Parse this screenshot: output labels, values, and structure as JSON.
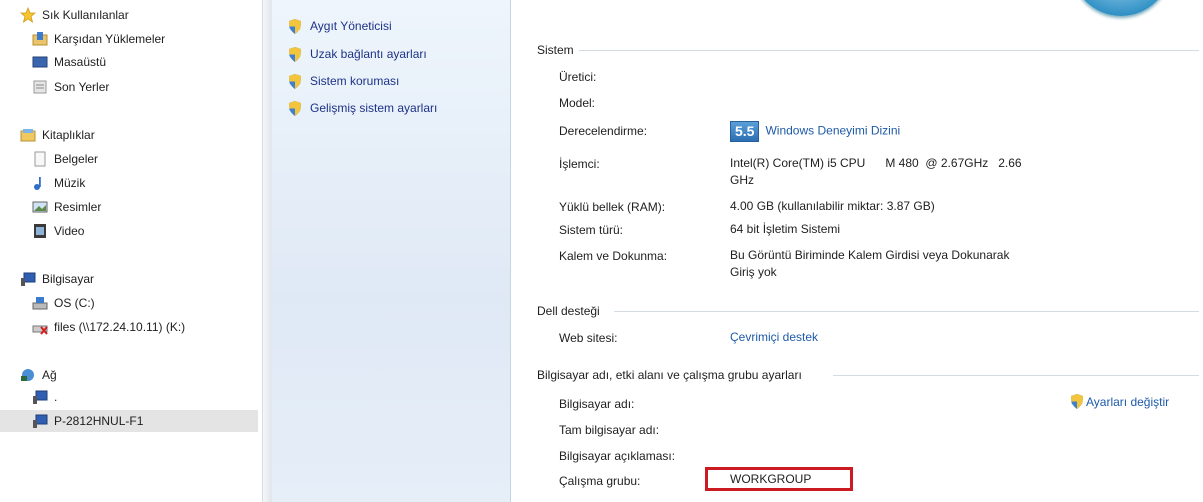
{
  "sidebar": {
    "favorites": {
      "label": "Sık Kullanılanlar",
      "items": [
        "Karşıdan Yüklemeler",
        "Masaüstü",
        "Son Yerler"
      ]
    },
    "libraries": {
      "label": "Kitaplıklar",
      "items": [
        "Belgeler",
        "Müzik",
        "Resimler",
        "Video"
      ]
    },
    "computer": {
      "label": "Bilgisayar",
      "items": [
        "OS (C:)",
        "files (\\\\172.24.10.11) (K:)"
      ]
    },
    "network": {
      "label": "Ağ",
      "items": [
        ".",
        "P-2812HNUL-F1"
      ]
    }
  },
  "tasks": [
    "Aygıt Yöneticisi",
    "Uzak bağlantı ayarları",
    "Sistem koruması",
    "Gelişmiş sistem ayarları"
  ],
  "system": {
    "title": "Sistem",
    "manufacturer_label": "Üretici:",
    "model_label": "Model:",
    "rating_label": "Derecelendirme:",
    "rating_score": "5.5",
    "rating_link": "Windows Deneyimi Dizini",
    "processor_label": "İşlemci:",
    "processor_value_line1": "Intel(R) Core(TM) i5 CPU      M 480  @ 2.67GHz   2.66",
    "processor_value_line2": "GHz",
    "ram_label": "Yüklü bellek (RAM):",
    "ram_value": "4.00 GB (kullanılabilir miktar: 3.87 GB)",
    "type_label": "Sistem türü:",
    "type_value": "64 bit İşletim Sistemi",
    "pen_label": "Kalem ve Dokunma:",
    "pen_value_line1": "Bu Görüntü Biriminde Kalem Girdisi veya Dokunarak",
    "pen_value_line2": "Giriş yok"
  },
  "dell": {
    "title": "Dell desteği",
    "website_label": "Web sitesi:",
    "website_link": "Çevrimiçi destek"
  },
  "computer_name": {
    "title": "Bilgisayar adı, etki alanı ve çalışma grubu ayarları",
    "name_label": "Bilgisayar adı:",
    "full_name_label": "Tam bilgisayar adı:",
    "description_label": "Bilgisayar açıklaması:",
    "workgroup_label": "Çalışma grubu:",
    "workgroup_value": "WORKGROUP",
    "change_settings": "Ayarları değiştir"
  },
  "colors": {
    "highlight_box": "#cc1a22",
    "link": "#1e5aa8",
    "task_link": "#1e3287"
  }
}
